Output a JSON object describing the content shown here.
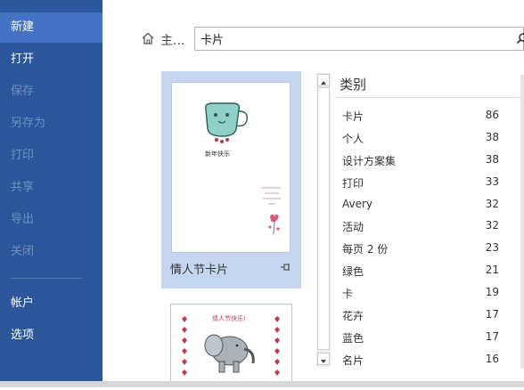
{
  "sidebar": {
    "items": [
      {
        "label": "新建",
        "state": "active"
      },
      {
        "label": "打开",
        "state": "normal"
      },
      {
        "label": "保存",
        "state": "disabled"
      },
      {
        "label": "另存为",
        "state": "disabled"
      },
      {
        "label": "打印",
        "state": "disabled"
      },
      {
        "label": "共享",
        "state": "disabled"
      },
      {
        "label": "导出",
        "state": "disabled"
      },
      {
        "label": "关闭",
        "state": "disabled"
      },
      {
        "label": "帐户",
        "state": "normal"
      },
      {
        "label": "选项",
        "state": "normal"
      }
    ]
  },
  "search": {
    "home_label": "主...",
    "value": "卡片",
    "home_icon": "home-icon",
    "search_icon": "magnifier-icon"
  },
  "templates": [
    {
      "name": "情人节卡片",
      "selected": true,
      "pin_icon": "pin-icon"
    },
    {
      "name": "",
      "selected": false
    }
  ],
  "thumb_text": {
    "t1_title": "新年快乐",
    "t2_title": "情人节快乐!"
  },
  "categories": {
    "title": "类别",
    "items": [
      {
        "label": "卡片",
        "count": "86"
      },
      {
        "label": "个人",
        "count": "38"
      },
      {
        "label": "设计方案集",
        "count": "38"
      },
      {
        "label": "打印",
        "count": "33"
      },
      {
        "label": "Avery",
        "count": "32"
      },
      {
        "label": "活动",
        "count": "32"
      },
      {
        "label": "每页 2 份",
        "count": "23"
      },
      {
        "label": "绿色",
        "count": "21"
      },
      {
        "label": "卡",
        "count": "19"
      },
      {
        "label": "花卉",
        "count": "17"
      },
      {
        "label": "蓝色",
        "count": "17"
      },
      {
        "label": "名片",
        "count": "16"
      }
    ]
  },
  "colors": {
    "sidebar_bg": "#2b579a",
    "sidebar_active": "#4472c4",
    "selected_card": "#c5d7f0"
  }
}
